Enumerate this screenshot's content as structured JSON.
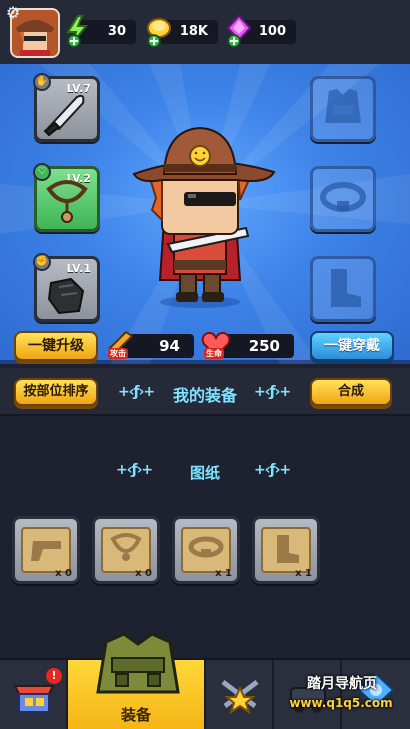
{
  "topbar": {
    "energy": "30",
    "gold": "18K",
    "gems": "100"
  },
  "slots": {
    "left": [
      {
        "level": "LV.7",
        "item": "knife"
      },
      {
        "level": "LV.2",
        "item": "necklace"
      },
      {
        "level": "LV.1",
        "item": "gloves"
      }
    ],
    "right": [
      {
        "item": "vest"
      },
      {
        "item": "belt"
      },
      {
        "item": "boots"
      }
    ]
  },
  "actions": {
    "upgrade_all": "一键升级",
    "equip_all": "一键穿戴"
  },
  "stats": {
    "attack_label": "攻击",
    "attack_value": "94",
    "hp_label": "生命",
    "hp_value": "250"
  },
  "bag": {
    "sort_label": "按部位排序",
    "title": "我的装备",
    "merge_label": "合成"
  },
  "blueprints": {
    "title": "图纸",
    "items": [
      {
        "type": "weapon",
        "count": "x 0"
      },
      {
        "type": "necklace",
        "count": "x 0"
      },
      {
        "type": "belt",
        "count": "x 1"
      },
      {
        "type": "boots",
        "count": "x 1"
      }
    ]
  },
  "nav": {
    "equipment_label": "装备",
    "watermark_title": "踏月导航页",
    "watermark_url": "www.q1q5.com"
  },
  "colors": {
    "accent_yellow": "#f5b414",
    "accent_blue": "#3d83e8",
    "title_cyan": "#7fe3ff"
  }
}
